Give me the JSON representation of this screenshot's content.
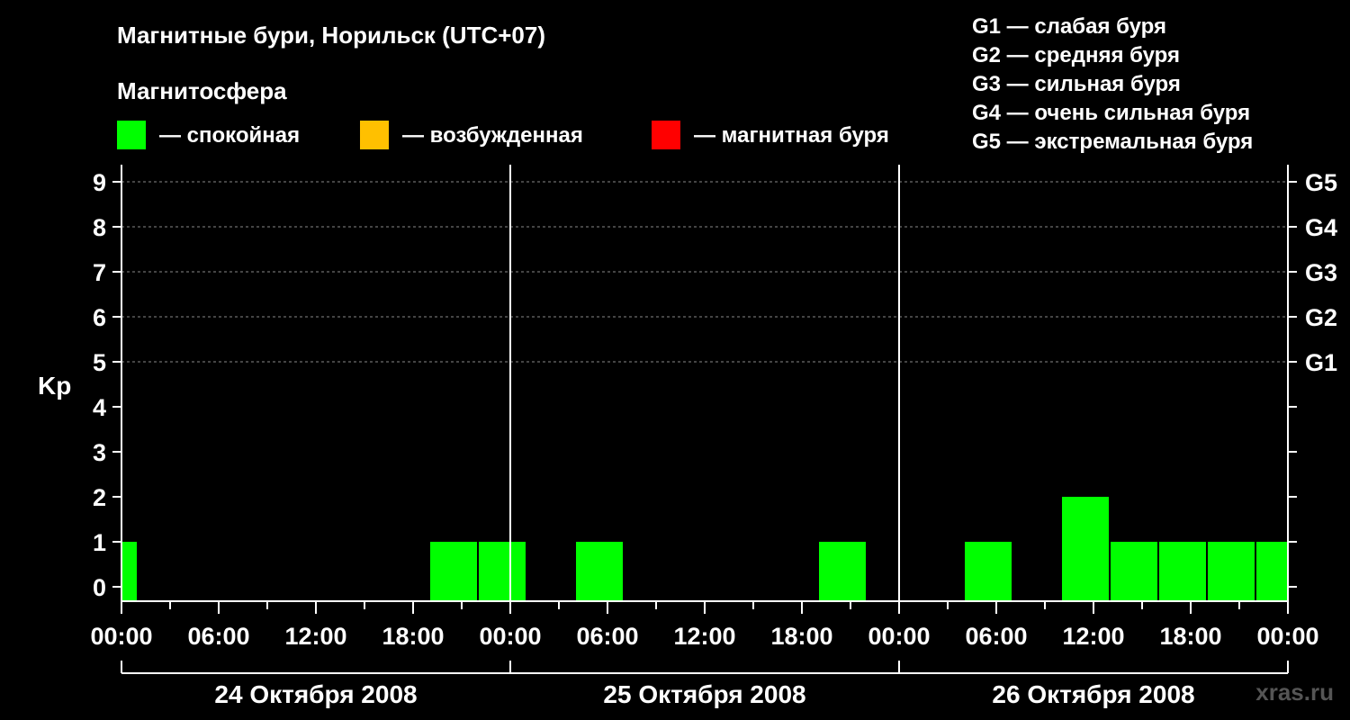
{
  "title": "Магнитные бури, Норильск (UTC+07)",
  "legend": {
    "heading": "Магнитосфера",
    "items": [
      {
        "label": "— спокойная",
        "color": "#00ff00"
      },
      {
        "label": "— возбужденная",
        "color": "#ffc000"
      },
      {
        "label": "— магнитная буря",
        "color": "#ff0000"
      }
    ]
  },
  "g_scale": [
    "G1 — слабая буря",
    "G2 — средняя буря",
    "G3 — сильная буря",
    "G4 — очень сильная буря",
    "G5 — экстремальная буря"
  ],
  "watermark": "xras.ru",
  "colors": {
    "background": "#000000",
    "quiet": "#00ff00",
    "grid": "#888888",
    "axis": "#ffffff"
  },
  "chart_data": {
    "type": "bar",
    "ylabel": "Kp",
    "ylim": [
      0,
      9
    ],
    "yticks": [
      "0",
      "1",
      "2",
      "3",
      "4",
      "5",
      "6",
      "7",
      "8",
      "9"
    ],
    "right_ticks": [
      {
        "kp": 5,
        "label": "G1"
      },
      {
        "kp": 6,
        "label": "G2"
      },
      {
        "kp": 7,
        "label": "G3"
      },
      {
        "kp": 8,
        "label": "G4"
      },
      {
        "kp": 9,
        "label": "G5"
      }
    ],
    "grid": "dashed at Kp 5–9",
    "xlim_hours": [
      0,
      72
    ],
    "xtick_labels": [
      "00:00",
      "06:00",
      "12:00",
      "18:00",
      "00:00",
      "06:00",
      "12:00",
      "18:00",
      "00:00",
      "06:00",
      "12:00",
      "18:00",
      "00:00"
    ],
    "days": [
      "24 Октября 2008",
      "25 Октября 2008",
      "26 Октября 2008"
    ],
    "bars": [
      {
        "start_hour": 0,
        "end_hour": 1,
        "kp": 1,
        "state": "quiet"
      },
      {
        "start_hour": 19,
        "end_hour": 22,
        "kp": 1,
        "state": "quiet"
      },
      {
        "start_hour": 22,
        "end_hour": 25,
        "kp": 1,
        "state": "quiet"
      },
      {
        "start_hour": 28,
        "end_hour": 31,
        "kp": 1,
        "state": "quiet"
      },
      {
        "start_hour": 43,
        "end_hour": 46,
        "kp": 1,
        "state": "quiet"
      },
      {
        "start_hour": 52,
        "end_hour": 55,
        "kp": 1,
        "state": "quiet"
      },
      {
        "start_hour": 58,
        "end_hour": 61,
        "kp": 2,
        "state": "quiet"
      },
      {
        "start_hour": 61,
        "end_hour": 64,
        "kp": 1,
        "state": "quiet"
      },
      {
        "start_hour": 64,
        "end_hour": 67,
        "kp": 1,
        "state": "quiet"
      },
      {
        "start_hour": 67,
        "end_hour": 70,
        "kp": 1,
        "state": "quiet"
      },
      {
        "start_hour": 70,
        "end_hour": 72,
        "kp": 1,
        "state": "quiet"
      }
    ]
  }
}
